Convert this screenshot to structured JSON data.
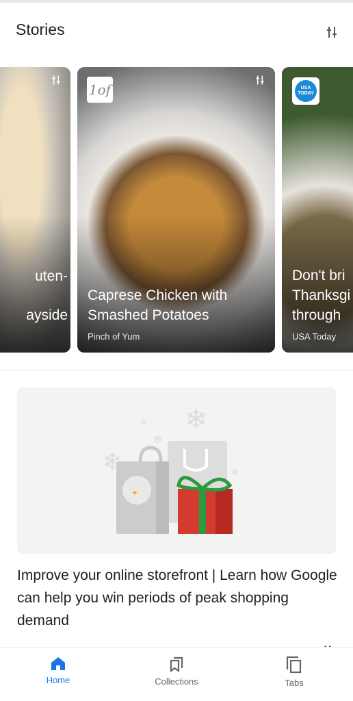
{
  "header": {
    "title": "Stories"
  },
  "stories": [
    {
      "title_line1": "uten-",
      "title_line2": "ayside",
      "source": ""
    },
    {
      "title_line1": "Caprese Chicken with",
      "title_line2": "Smashed Potatoes",
      "source": "Pinch of Yum",
      "logo": "1of"
    },
    {
      "title_line1": "Don't bri",
      "title_line2": "Thanksgi",
      "title_line3": "through",
      "source": "USA Today",
      "logo": "USA TODAY"
    }
  ],
  "promo": {
    "text": "Improve your online storefront | Learn how Google can help you win periods of peak shopping demand"
  },
  "nav": {
    "items": [
      {
        "label": "Home",
        "active": true
      },
      {
        "label": "Collections"
      },
      {
        "label": "Tabs"
      }
    ]
  },
  "colors": {
    "accent": "#1a73e8",
    "inactive": "#666666"
  }
}
